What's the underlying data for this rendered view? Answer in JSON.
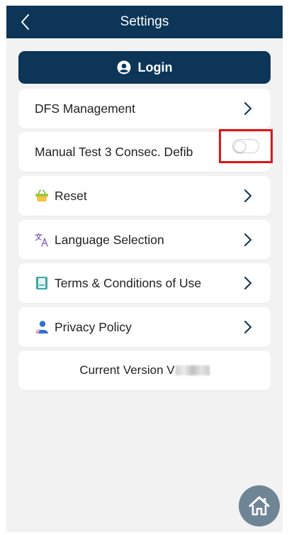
{
  "header": {
    "title": "Settings"
  },
  "login": {
    "label": "Login"
  },
  "items": [
    {
      "label": "DFS Management"
    },
    {
      "label": "Manual Test 3 Consec. Defib",
      "toggle_on": false
    },
    {
      "label": "Reset",
      "icon": "basket-icon"
    },
    {
      "label": "Language Selection",
      "icon": "translate-icon"
    },
    {
      "label": "Terms & Conditions of Use",
      "icon": "document-icon"
    },
    {
      "label": "Privacy Policy",
      "icon": "person-icon"
    }
  ],
  "version": {
    "label": "Current Version V"
  },
  "colors": {
    "header": "#0c3558",
    "highlight": "#e31416",
    "home": "#6e8596"
  }
}
